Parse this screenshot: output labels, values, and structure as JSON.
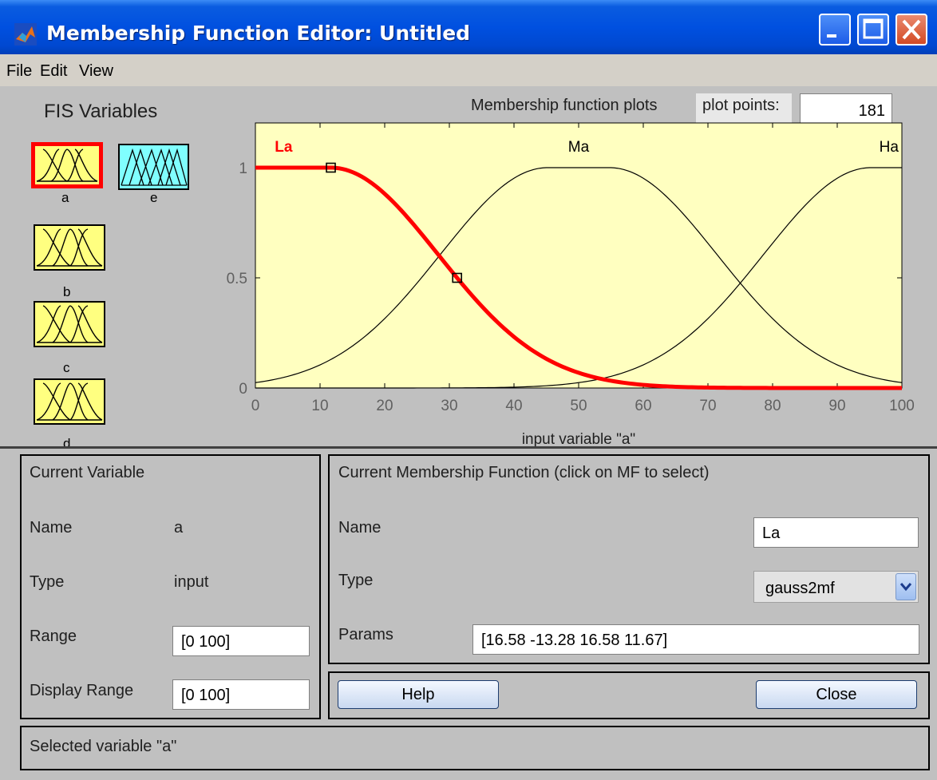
{
  "window": {
    "title": "Membership Function Editor: Untitled"
  },
  "menu": [
    "File",
    "Edit",
    "View"
  ],
  "fis_variables": {
    "heading": "FIS Variables",
    "items": [
      {
        "label": "a",
        "selected": true,
        "color": "#ffff80",
        "kind": "gaussian"
      },
      {
        "label": "e",
        "selected": false,
        "color": "#80ffff",
        "kind": "triangular"
      },
      {
        "label": "b",
        "selected": false,
        "color": "#ffff80",
        "kind": "gaussian"
      },
      {
        "label": "c",
        "selected": false,
        "color": "#ffff80",
        "kind": "gaussian"
      },
      {
        "label": "d",
        "selected": false,
        "color": "#ffff80",
        "kind": "gaussian"
      }
    ]
  },
  "plot_header": {
    "title": "Membership function plots",
    "plot_points_label": "plot points:",
    "plot_points_value": "181"
  },
  "chart_data": {
    "type": "line",
    "xlabel": "input variable \"a\"",
    "xlim": [
      0,
      100
    ],
    "ylim": [
      0,
      1
    ],
    "x_ticks": [
      "0",
      "10",
      "20",
      "30",
      "40",
      "50",
      "60",
      "70",
      "80",
      "90",
      "100"
    ],
    "y_ticks": [
      "0",
      "0.5",
      "1"
    ],
    "background": "#ffffc0",
    "series": [
      {
        "name": "La",
        "mf": "gauss2mf",
        "params": [
          16.58,
          -13.28,
          16.58,
          11.67
        ],
        "color": "#ff0000",
        "selected": true
      },
      {
        "name": "Ma",
        "mf": "gauss2mf",
        "params": [
          16.58,
          45.2,
          16.58,
          54.8
        ],
        "color": "#000000",
        "selected": false
      },
      {
        "name": "Ha",
        "mf": "gauss2mf",
        "params": [
          16.58,
          95.2,
          16.58,
          113.3
        ],
        "color": "#000000",
        "selected": false
      }
    ],
    "handles": [
      [
        11.67,
        1.0
      ],
      [
        31.2,
        0.5
      ]
    ]
  },
  "current_variable": {
    "heading": "Current Variable",
    "name_label": "Name",
    "name_value": "a",
    "type_label": "Type",
    "type_value": "input",
    "range_label": "Range",
    "range_value": "[0 100]",
    "display_range_label": "Display Range",
    "display_range_value": "[0 100]"
  },
  "current_mf": {
    "heading": "Current Membership Function (click on MF to select)",
    "name_label": "Name",
    "name_value": "La",
    "type_label": "Type",
    "type_value": "gauss2mf",
    "params_label": "Params",
    "params_value": "[16.58 -13.28 16.58 11.67]"
  },
  "buttons": {
    "help": "Help",
    "close": "Close"
  },
  "status": "Selected variable \"a\""
}
